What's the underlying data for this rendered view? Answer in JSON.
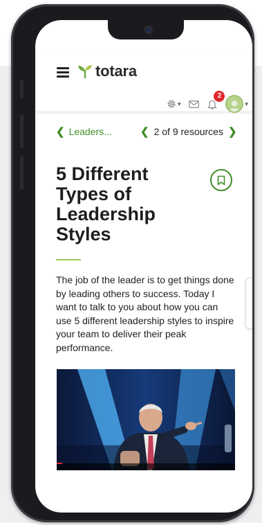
{
  "header": {
    "logo_text": "totara",
    "notification_count": "2",
    "icons": [
      "menu-icon",
      "gear-icon",
      "mail-icon",
      "bell-icon",
      "avatar-icon"
    ]
  },
  "nav": {
    "back_label": "Leaders...",
    "pager_label": "2 of 9 resources"
  },
  "resource": {
    "title": "5 Different Types of Leadership Styles",
    "description": "The job of the leader is to get things done by leading others to success. Today I want to talk to you about how you can use 5 different leadership styles to inspire your team to deliver their peak performance.",
    "video_progress": 0.03
  },
  "colors": {
    "accent": "#3f8f26",
    "badge": "#e0282e",
    "divider": "#9cc45a"
  }
}
